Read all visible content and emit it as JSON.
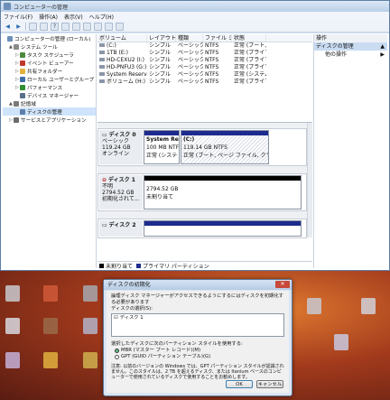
{
  "window": {
    "title": "コンピューターの管理",
    "menu": [
      "ファイル(F)",
      "操作(A)",
      "表示(V)",
      "ヘルプ(H)"
    ]
  },
  "tree": [
    {
      "label": "コンピューターの管理 (ローカル)",
      "indent": 0,
      "exp": "",
      "color": "#6d8fb8",
      "icon": "computer-icon"
    },
    {
      "label": "システム ツール",
      "indent": 1,
      "exp": "▲",
      "color": "#8a8a8a",
      "icon": "tools-icon"
    },
    {
      "label": "タスク スケジューラ",
      "indent": 2,
      "exp": "▷",
      "color": "#4b8a3c",
      "icon": "clock-icon"
    },
    {
      "label": "イベント ビューアー",
      "indent": 2,
      "exp": "▷",
      "color": "#c0392b",
      "icon": "event-icon"
    },
    {
      "label": "共有フォルダー",
      "indent": 2,
      "exp": "▷",
      "color": "#e3b23c",
      "icon": "folder-icon"
    },
    {
      "label": "ローカル ユーザーとグループ",
      "indent": 2,
      "exp": "▷",
      "color": "#3f6ea8",
      "icon": "users-icon"
    },
    {
      "label": "パフォーマンス",
      "indent": 2,
      "exp": "▷",
      "color": "#2f8f2f",
      "icon": "chart-icon"
    },
    {
      "label": "デバイス マネージャー",
      "indent": 2,
      "exp": "",
      "color": "#5a6f88",
      "icon": "device-icon"
    },
    {
      "label": "記憶域",
      "indent": 1,
      "exp": "▲",
      "color": "#7a7a7a",
      "icon": "storage-icon"
    },
    {
      "label": "ディスクの管理",
      "indent": 2,
      "exp": "",
      "color": "#5b7fa8",
      "icon": "disk-icon",
      "selected": true
    },
    {
      "label": "サービスとアプリケーション",
      "indent": 1,
      "exp": "▷",
      "color": "#6a6a6a",
      "icon": "services-icon"
    }
  ],
  "volumes": {
    "headers": [
      "ボリューム",
      "レイアウト",
      "種類",
      "ファイル システム",
      "状態"
    ],
    "rows": [
      [
        "(C:)",
        "シンプル",
        "ベーシック",
        "NTFS",
        "正常 (ブート, ページ ファイ"
      ],
      [
        "1TB (E:)",
        "シンプル",
        "ベーシック",
        "NTFS",
        "正常 (プライマリ パーティシ"
      ],
      [
        "HD-CEXU2 (I:)",
        "シンプル",
        "ベーシック",
        "NTFS",
        "正常 (プライマリ パーティシ"
      ],
      [
        "HD-PNFU3 (G:)",
        "シンプル",
        "ベーシック",
        "NTFS",
        "正常 (プライマリ パーティシ"
      ],
      [
        "System Reserved",
        "シンプル",
        "ベーシック",
        "NTFS",
        "正常 (システム, アクティブ"
      ],
      [
        "ボリューム (H:)",
        "シンプル",
        "ベーシック",
        "NTFS",
        "正常 (プライマリ パーティシ"
      ]
    ]
  },
  "disks": [
    {
      "name": "ディスク 0",
      "l1": "ベーシック",
      "l2": "119.24 GB",
      "l3": "オンライン",
      "p1_name": "System Res",
      "p1_l1": "100 MB NTFS",
      "p1_l2": "正常 (システ",
      "p2_name": "(C:)",
      "p2_l1": "119.14 GB NTFS",
      "p2_l2": "正常 (ブート, ページ ファイル, クラッ"
    },
    {
      "name": "ディスク 1",
      "l1": "不明",
      "l2": "2794.52 GB",
      "l3": "初期化されて...",
      "p1_l1": "2794.52 GB",
      "p1_l2": "未割り当て"
    },
    {
      "name": "ディスク 2"
    }
  ],
  "legend": {
    "unalloc": "未割り当て",
    "primary": "プライマリ パーティション"
  },
  "ops": {
    "header": "操作",
    "selected": "ディスクの管理",
    "item": "他の操作"
  },
  "dialog": {
    "title": "ディスクの初期化",
    "intro": "論理ディスク マネージャーがアクセスできるようにするにはディスクを初期化する必要があります",
    "select_label": "ディスクの選択(S):",
    "disk_item": "ディスク 1",
    "style_label": "選択したディスクに次のパーティション スタイルを使用する:",
    "mbr": "MBR (マスター ブート レコード)(M)",
    "gpt": "GPT (GUID パーティション テーブル)(G)",
    "note": "注意: 以前のバージョンの Windows では、GPT パーティション スタイルが認識されません。このスタイルは、2 TB を超えるディスク、または Itanium ベースのコンピューターで使用されているディスクで使用することをお勧めします。",
    "ok": "OK",
    "cancel": "キャンセル"
  }
}
